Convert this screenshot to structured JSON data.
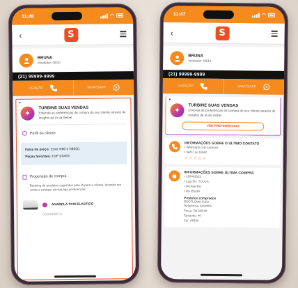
{
  "status": {
    "left_time": "11:48",
    "right_time": "11:47"
  },
  "left": {
    "user_name": "BRUNA",
    "user_sub": "Vendedor: 09/10",
    "phone": "(21) 99999-9999",
    "call_label": "LIGAÇÃO",
    "whatsapp_label": "WHATSAPP",
    "turbine_title": "TURBINE SUAS VENDAS",
    "turbine_desc": "Entenda as preferências de compra do seu cliente através de insights da IA da Seibel",
    "profile_title": "Perfil do cliente",
    "price_label": "Faixa de preço:",
    "price_value": "Entre R$0 e R$350.",
    "brand_label": "Peças favoritas:",
    "brand_value": "TOP SIDER",
    "purchase_title": "Propensão de compra",
    "purchase_desc": "Ranking de produtos sugeridos pela IA para o cliente, levando em conta o estoque da sua loja preferencial.",
    "product_name": "ANABELA PAM ELASTICO",
    "product_sub": "CODDI/PRETO"
  },
  "right": {
    "user_name": "BRUNA",
    "user_sub": "Vendedor: 09/10",
    "phone": "(21) 99999-9999",
    "call_label": "LIGAÇÃO",
    "whatsapp_label": "WHATSAPP",
    "turbine_title": "TURBINE SUAS VENDAS",
    "turbine_desc": "Entenda as preferências de compra do seu cliente através de insights da IA da Seibel",
    "pref_button": "VER PREFERÊNCIAS",
    "contact_title": "INFORMAÇÕES SOBRE O ÚLTIMO CONTATO",
    "contact_line1": "• Whatsapp com sucesso",
    "contact_line2": "• 04/07 às 16h42",
    "purchase_title": "INFORMAÇÕES SOBRE ÚLTIMA COMPRA",
    "purchase_line1": "• 15/04/2023",
    "purchase_line2": "• Loja SH. TIJUCA",
    "purchase_line3": "• Michael Ba",
    "purchase_line4": "• R$ 359,99",
    "products_label": "Produtos comprados",
    "prod_line1": "BOOTLOWA FLEX",
    "prod_line2": "Referência: A350001",
    "prod_line3": "Preço: R$ 359,99",
    "prod_line4": "Tamanho: 40",
    "prod_line5": "Cor: AREIA"
  },
  "colors": {
    "brand_orange": "#f58a1f",
    "brand_red": "#ee4d23",
    "accent_purple": "#a93fd0"
  },
  "icons": [
    "chevron-left-icon",
    "logo-icon",
    "menu-icon",
    "user-icon",
    "phone-icon",
    "whatsapp-icon",
    "sparkle-icon",
    "star-icon",
    "bag-icon"
  ]
}
